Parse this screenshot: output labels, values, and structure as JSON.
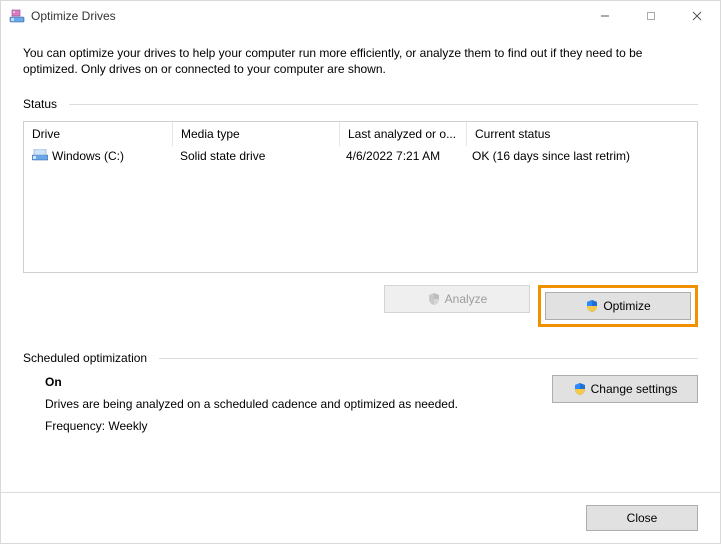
{
  "window": {
    "title": "Optimize Drives"
  },
  "intro": "You can optimize your drives to help your computer run more efficiently, or analyze them to find out if they need to be optimized. Only drives on or connected to your computer are shown.",
  "status_section": {
    "label": "Status",
    "columns": {
      "drive": "Drive",
      "media": "Media type",
      "last": "Last analyzed or o...",
      "status": "Current status"
    },
    "rows": [
      {
        "drive": "Windows (C:)",
        "media": "Solid state drive",
        "last": "4/6/2022 7:21 AM",
        "status": "OK (16 days since last retrim)"
      }
    ]
  },
  "buttons": {
    "analyze": "Analyze",
    "optimize": "Optimize",
    "change_settings": "Change settings",
    "close": "Close"
  },
  "scheduled": {
    "header": "Scheduled optimization",
    "state": "On",
    "desc": "Drives are being analyzed on a scheduled cadence and optimized as needed.",
    "frequency": "Frequency: Weekly"
  }
}
